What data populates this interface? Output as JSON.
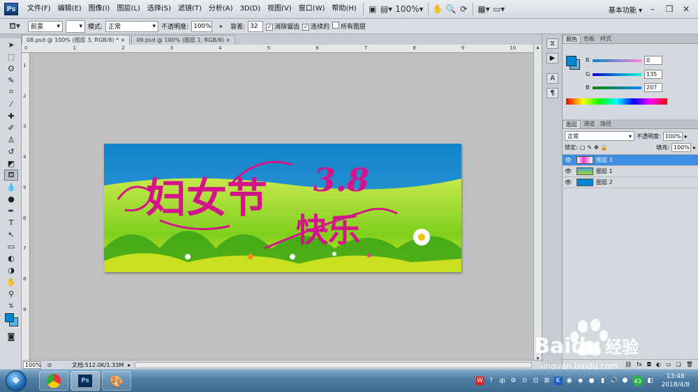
{
  "app": {
    "logo": "Ps"
  },
  "menu": [
    "文件(F)",
    "编辑(E)",
    "图像(I)",
    "图层(L)",
    "选择(S)",
    "滤镜(T)",
    "分析(A)",
    "3D(D)",
    "视图(V)",
    "窗口(W)",
    "帮助(H)"
  ],
  "menubar": {
    "zoom": "100%",
    "workspace": "基本功能"
  },
  "options": {
    "fill_source": "前景",
    "mode_label": "模式:",
    "mode_value": "正常",
    "opacity_label": "不透明度:",
    "opacity_value": "100%",
    "tolerance_label": "容差:",
    "tolerance_value": "32",
    "anti_alias": "消除锯齿",
    "contiguous": "连续的",
    "all_layers": "所有图层"
  },
  "tabs": [
    "08.psd @ 100% (图层 3, RGB/8) *",
    "09.psd @ 100% (图层 1, RGB/8)"
  ],
  "ruler": {
    "top": [
      "0",
      "1",
      "2",
      "3",
      "4",
      "5",
      "6",
      "7",
      "8",
      "9",
      "10"
    ],
    "left": [
      "1",
      "2",
      "3",
      "4",
      "5",
      "6",
      "7",
      "8",
      "9"
    ]
  },
  "status": {
    "zoom": "100%",
    "doc": "文档:512.0K/1.33M"
  },
  "banner": {
    "title": "妇女节",
    "subtitle": "快乐",
    "number": "3.8"
  },
  "color_panel": {
    "tabs": [
      "颜色",
      "色板",
      "样式"
    ],
    "r_label": "R",
    "g_label": "G",
    "b_label": "B",
    "r": "0",
    "g": "135",
    "b": "207",
    "fg": "#0087cf"
  },
  "layers_panel": {
    "tabs": [
      "图层",
      "通道",
      "路径"
    ],
    "blend": "正常",
    "opacity_label": "不透明度:",
    "opacity": "100%",
    "lock_label": "锁定:",
    "fill_label": "填充:",
    "fill": "100%",
    "layers": [
      {
        "name": "图层 3"
      },
      {
        "name": "图层 1"
      },
      {
        "name": "图层 2"
      }
    ]
  },
  "taskbar": {
    "time": "13:48",
    "date": "2018/4/8",
    "ime": "中",
    "badge": "43"
  },
  "watermark": {
    "brand": "Bai",
    "brand2": "du",
    "cn": "经验",
    "url": "jingyan.baidu.com"
  }
}
